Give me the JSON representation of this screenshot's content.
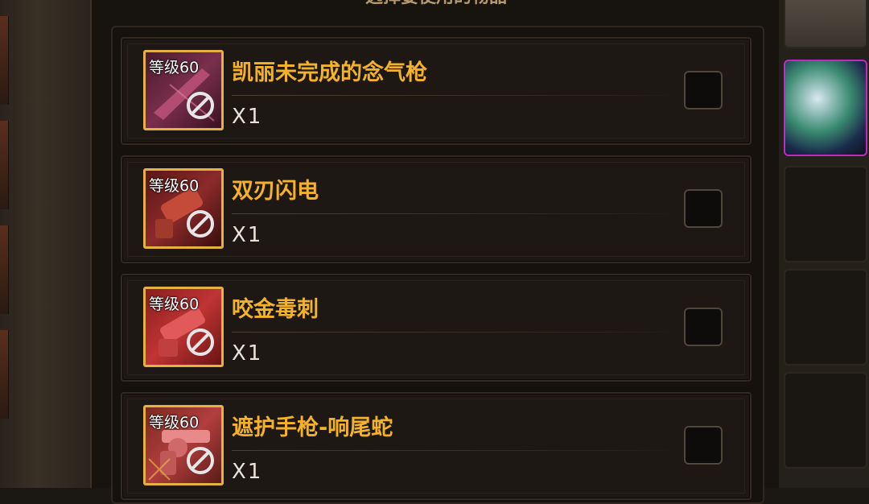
{
  "panel": {
    "title": "选择要使用的物品"
  },
  "items": [
    {
      "level": "等级60",
      "name": "凯丽未完成的念气枪",
      "qty": "X1",
      "icon": "gun-icon",
      "color": "#7a2f4c"
    },
    {
      "level": "等级60",
      "name": "双刃闪电",
      "qty": "X1",
      "icon": "gun-icon",
      "color": "#8c2a2a"
    },
    {
      "level": "等级60",
      "name": "咬金毒刺",
      "qty": "X1",
      "icon": "gun-icon",
      "color": "#b03030"
    },
    {
      "level": "等级60",
      "name": "遮护手枪-响尾蛇",
      "qty": "X1",
      "icon": "revolver-icon",
      "color": "#b23e3e"
    }
  ],
  "colors": {
    "name": "#f4b22a",
    "frame": "#e3b243",
    "qty": "#e8e2d8"
  }
}
